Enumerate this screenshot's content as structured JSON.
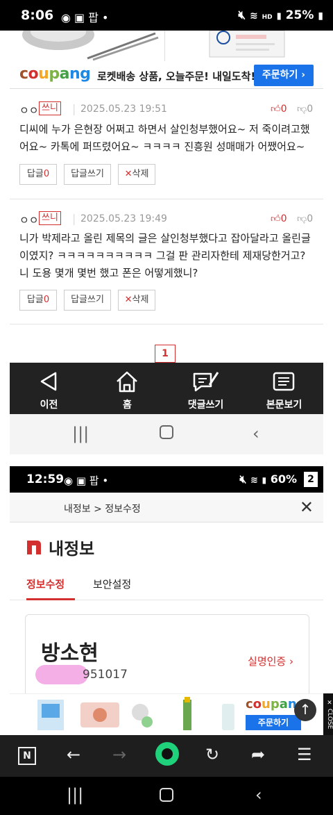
{
  "status1": {
    "time": "8:06",
    "battery": "25%",
    "indicators": "HD"
  },
  "banner": {
    "logo": "coupang",
    "text": "로켓배송 상품, 오늘주문! 내일도착!",
    "button": "주문하기 ›"
  },
  "comments": [
    {
      "user": "ㅇㅇ",
      "badge": "쓰니",
      "date": "2025.05.23 19:51",
      "up": "0",
      "down": "0",
      "text": "디씨에 누가 은현장 어쩌고 하면서 살인청부했어요~ 저 죽이려고했어요~ 카톡에 퍼뜨렸어요~ ㅋㅋㅋㅋ 진흥원 성매매가 어쨌어요~",
      "reply_label": "답글",
      "reply_count": "0",
      "write_reply": "답글쓰기",
      "delete": "삭제"
    },
    {
      "user": "ㅇㅇ",
      "badge": "쓰니",
      "date": "2025.05.23 19:49",
      "up": "0",
      "down": "0",
      "text": "니가 박제라고 올린 제목의 글은 살인청부했다고 잡아달라고 올린글이였지? ㅋㅋㅋㅋㅋㅋㅋㅋㅋㅋ 그걸 판 관리자한테 제재당한거고? 니 도용 몇개 몇번 했고 폰은 어떻게했니?",
      "reply_label": "답글",
      "reply_count": "0",
      "write_reply": "답글쓰기",
      "delete": "삭제"
    }
  ],
  "page_number": "1",
  "bottom_nav": [
    {
      "label": "이전",
      "icon": "back-triangle-icon"
    },
    {
      "label": "홈",
      "icon": "home-icon"
    },
    {
      "label": "댓글쓰기",
      "icon": "comment-write-icon"
    },
    {
      "label": "본문보기",
      "icon": "document-icon"
    }
  ],
  "shot2": {
    "number": "2",
    "status": {
      "time": "12:59",
      "battery": "60%"
    },
    "breadcrumb": "내정보 > 정보수정",
    "title": "내정보",
    "tabs": [
      "정보수정",
      "보안설정"
    ],
    "name": "방소현",
    "birth": "951017",
    "verify": "실명인증 ›"
  },
  "ad": {
    "logo": "coupang",
    "button": "주문하기",
    "close": "CLOSE"
  },
  "colors": {
    "accent": "#d32f2f",
    "coupang_blue": "#1a73e8",
    "green": "#1fd17a"
  }
}
